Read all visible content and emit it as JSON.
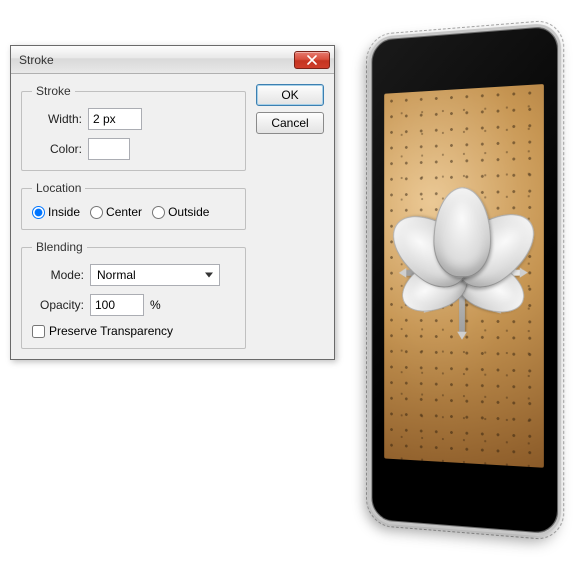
{
  "dialog": {
    "title": "Stroke",
    "buttons": {
      "ok": "OK",
      "cancel": "Cancel"
    }
  },
  "stroke": {
    "legend": "Stroke",
    "width_label": "Width:",
    "width_value": "2 px",
    "color_label": "Color:",
    "color_hex": "#ffffff"
  },
  "location": {
    "legend": "Location",
    "options": {
      "inside": "Inside",
      "center": "Center",
      "outside": "Outside"
    },
    "selected": "inside"
  },
  "blending": {
    "legend": "Blending",
    "mode_label": "Mode:",
    "mode_value": "Normal",
    "opacity_label": "Opacity:",
    "opacity_value": "100",
    "opacity_suffix": "%",
    "preserve_label": "Preserve Transparency",
    "preserve_checked": false
  }
}
